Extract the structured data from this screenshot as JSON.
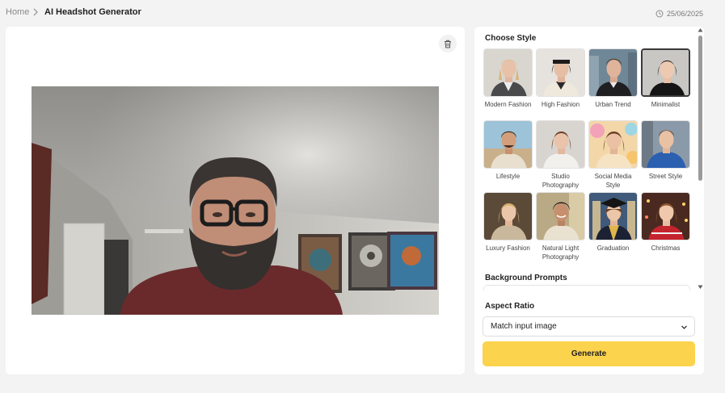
{
  "breadcrumb": {
    "home": "Home",
    "current": "AI Headshot Generator"
  },
  "date": "25/06/2025",
  "styles_section": {
    "title": "Choose Style",
    "selected": "Minimalist",
    "items": [
      {
        "label": "Modern Fashion"
      },
      {
        "label": "High Fashion"
      },
      {
        "label": "Urban Trend"
      },
      {
        "label": "Minimalist"
      },
      {
        "label": "Lifestyle"
      },
      {
        "label": "Studio Photography"
      },
      {
        "label": "Social Media Style"
      },
      {
        "label": "Street Style"
      },
      {
        "label": "Luxury Fashion"
      },
      {
        "label": "Natural Light Photography"
      },
      {
        "label": "Graduation"
      },
      {
        "label": "Christmas"
      }
    ]
  },
  "background_prompts": {
    "title": "Background Prompts"
  },
  "aspect_ratio": {
    "title": "Aspect Ratio",
    "value": "Match input image"
  },
  "generate": {
    "label": "Generate"
  },
  "colors": {
    "accent": "#fcd34d",
    "panel": "#ffffff",
    "page": "#f3f3f4"
  }
}
